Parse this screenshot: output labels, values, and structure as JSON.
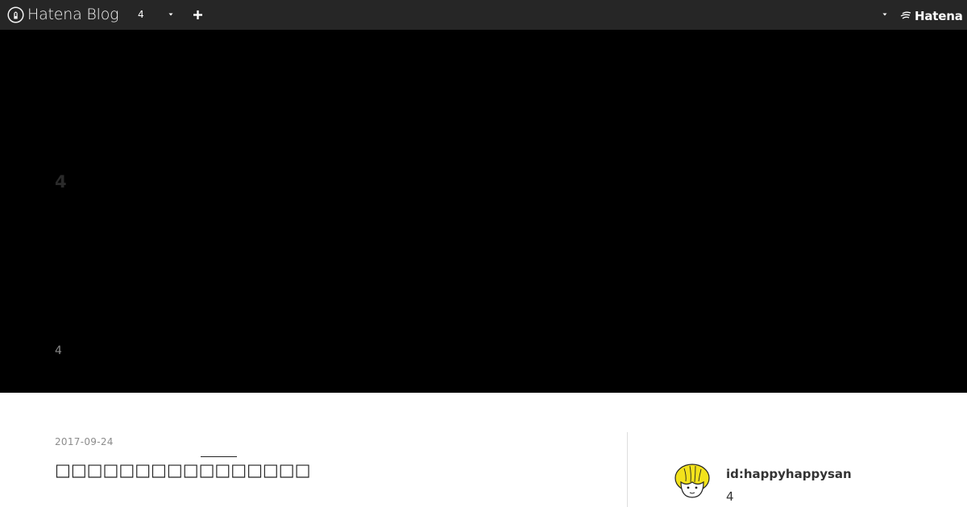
{
  "topbar": {
    "brand": "Hatena Blog",
    "blog_count": "4",
    "hatena_label": "Hatena"
  },
  "hero": {
    "title": "4",
    "description": "4"
  },
  "article": {
    "date": "2017-09-24",
    "title": "□□□□□□□□□□□□□□□□"
  },
  "profile": {
    "id": "id:happyhappysan",
    "description": "4"
  },
  "colors": {
    "topbar_bg": "#262626",
    "hero_bg": "#000000",
    "avatar_hair": "#f2e21c"
  },
  "icons": [
    "hatena-blog-logo-icon",
    "chevron-down-icon",
    "plus-icon",
    "hatena-wave-icon"
  ]
}
